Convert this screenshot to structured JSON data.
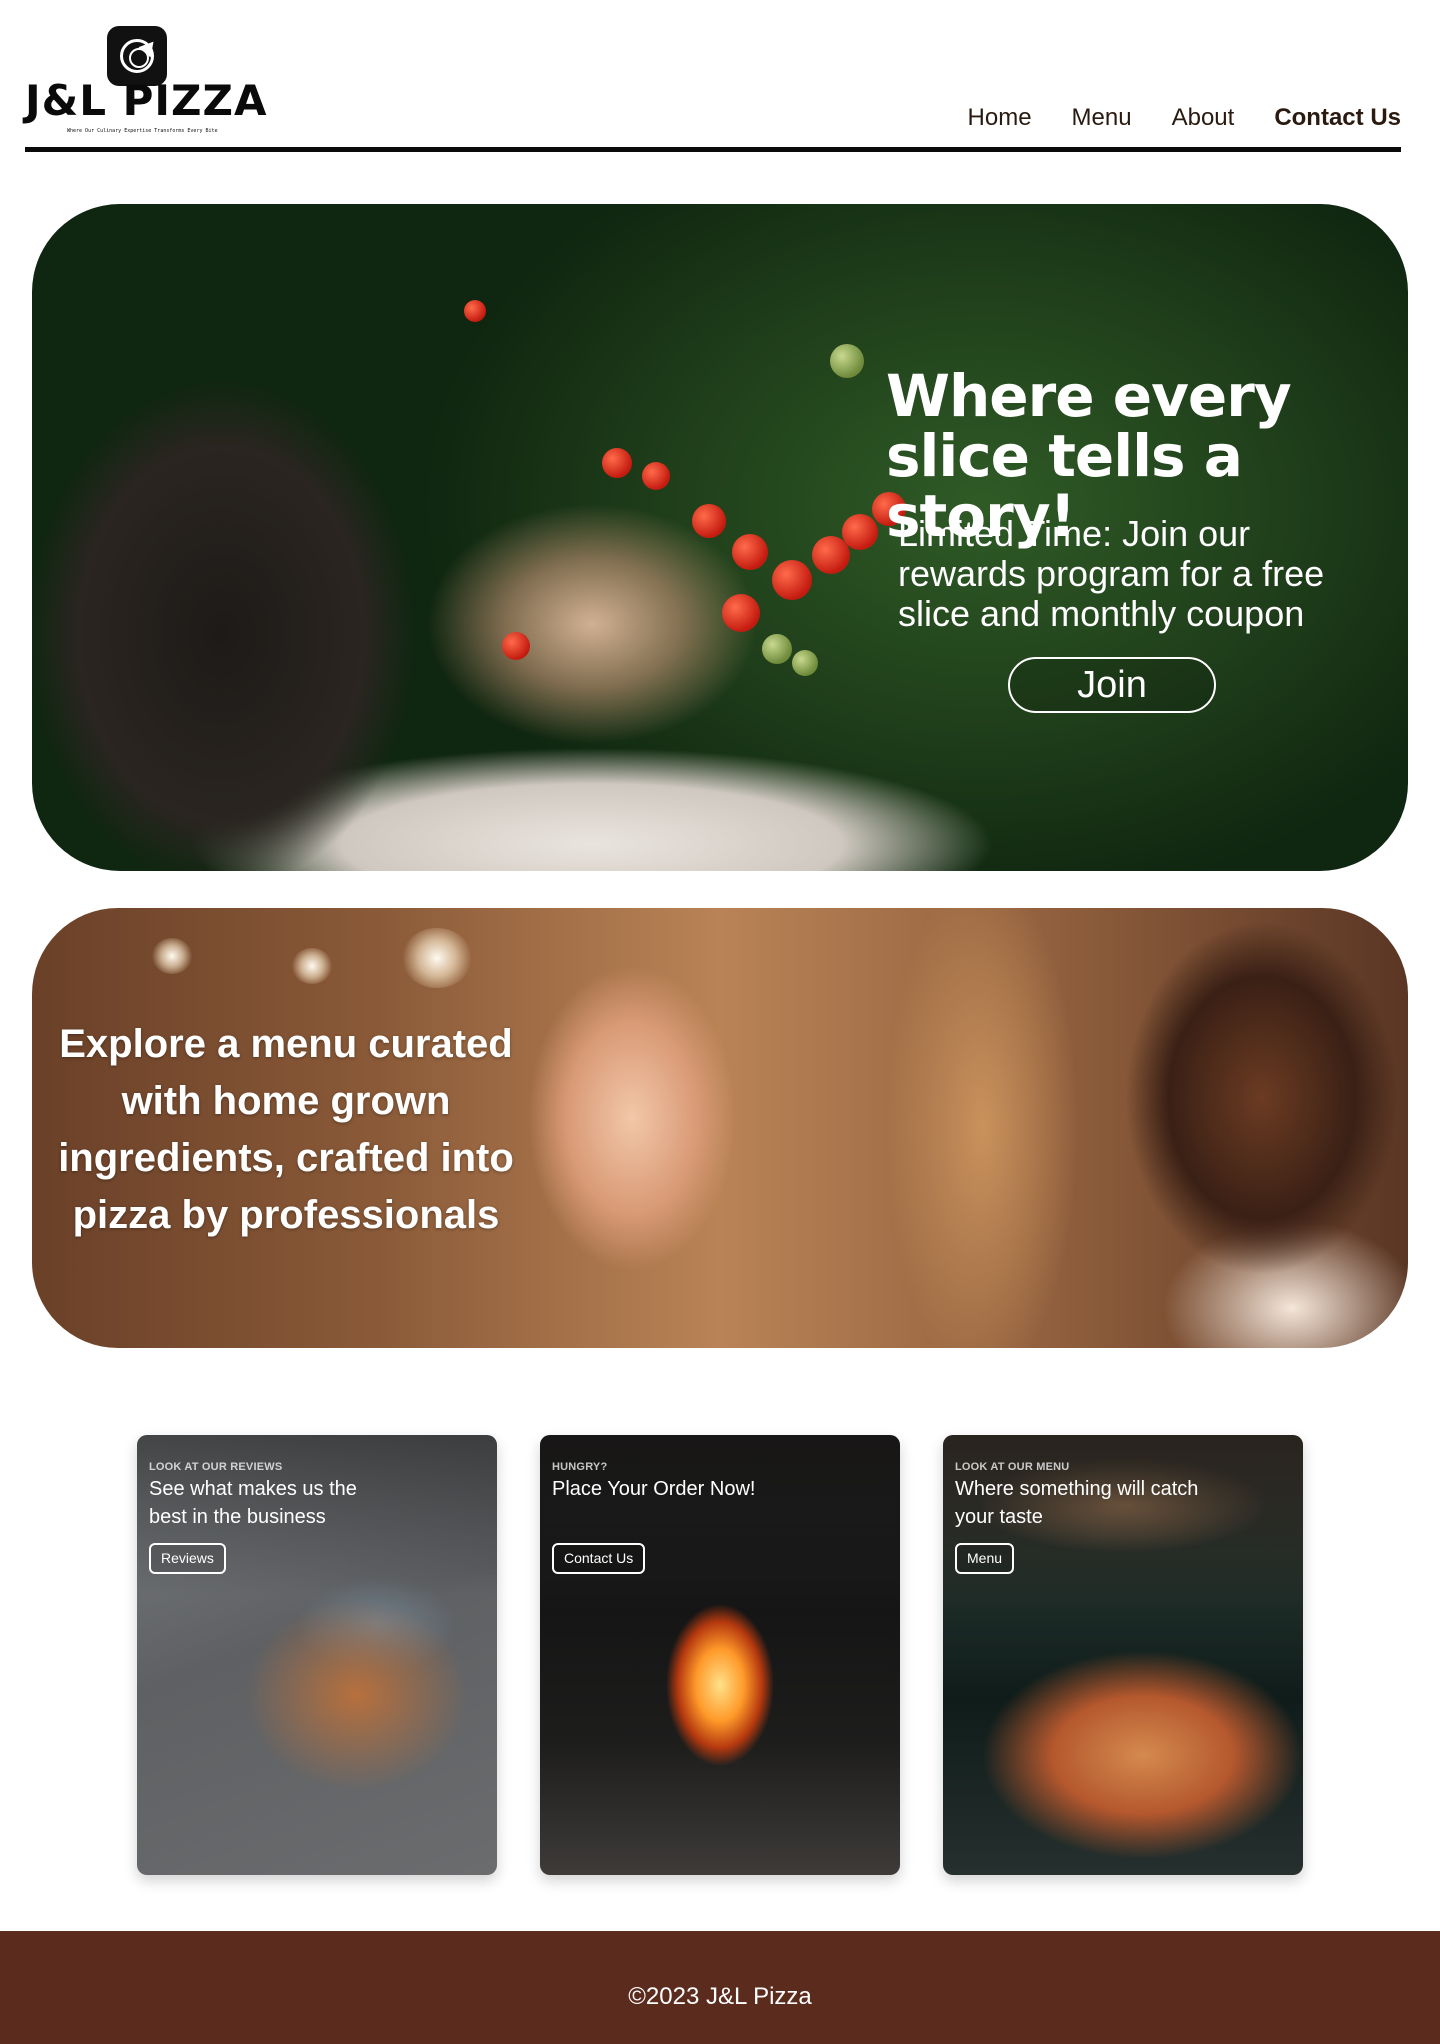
{
  "brand": {
    "name": "J&L PIZZA",
    "tagline": "Where Our Culinary Expertise Transforms Every Bite"
  },
  "nav": {
    "items": [
      {
        "label": "Home"
      },
      {
        "label": "Menu"
      },
      {
        "label": "About"
      },
      {
        "label": "Contact Us",
        "active": true
      }
    ]
  },
  "hero": {
    "title": "Where every slice tells a story!",
    "promo": "Limited Time: Join our rewards program for a free slice and monthly coupon",
    "button_label": "Join"
  },
  "banner": {
    "text": "Explore a menu curated with home grown ingredients, crafted into pizza by professionals"
  },
  "cards": [
    {
      "eyebrow": "LOOK AT OUR REVIEWS",
      "headline": "See what makes us the best in the business",
      "button_label": "Reviews"
    },
    {
      "eyebrow": "HUNGRY?",
      "headline": "Place Your Order Now!",
      "button_label": "Contact Us"
    },
    {
      "eyebrow": "LOOK AT OUR MENU",
      "headline": "Where something will catch your taste",
      "button_label": "Menu"
    }
  ],
  "footer": {
    "text": "©2023 J&L Pizza"
  },
  "colors": {
    "footer_bg": "#5b2c1e",
    "nav_text": "#2b1a10",
    "header_rule": "#0a0a0a"
  }
}
